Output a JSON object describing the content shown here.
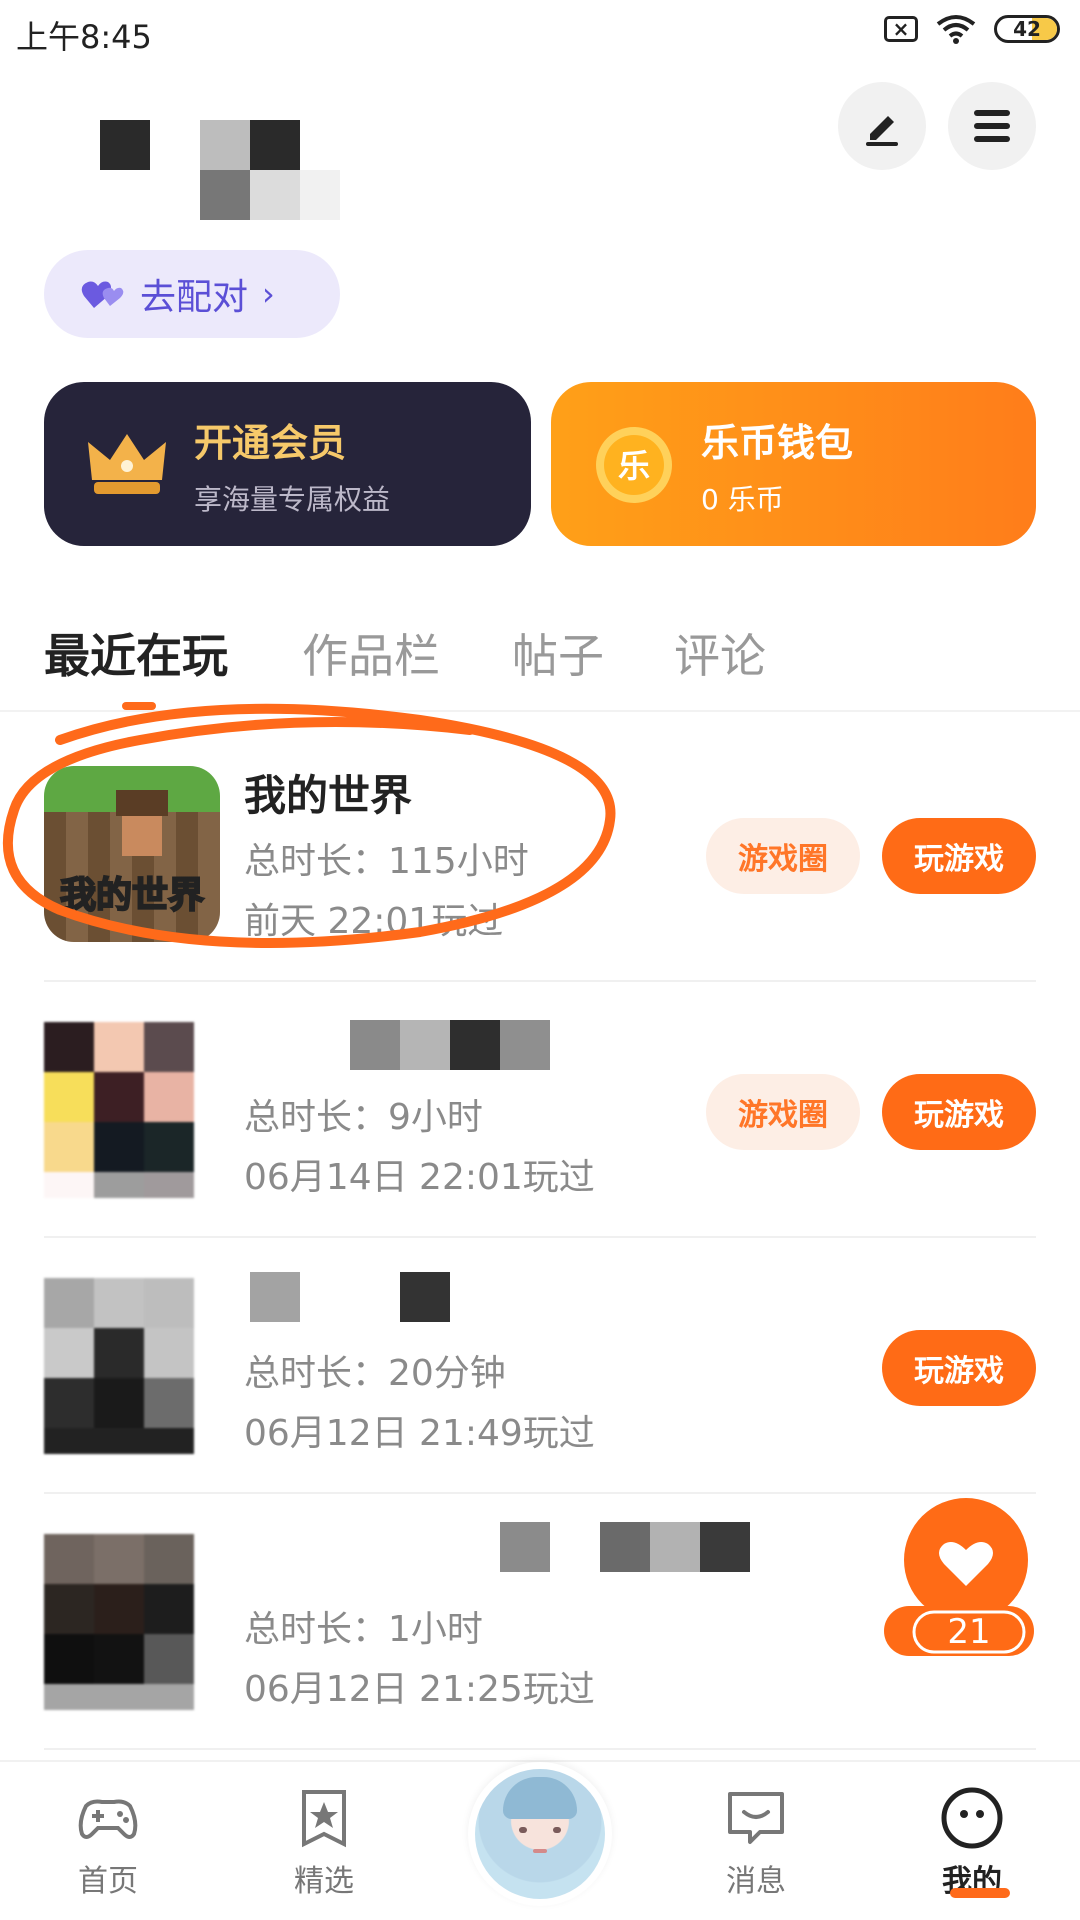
{
  "status_bar": {
    "time": "上午8:45",
    "battery": "42"
  },
  "header": {
    "match_label": "去配对",
    "edit_icon": "edit-icon",
    "menu_icon": "menu-icon"
  },
  "cards": {
    "vip": {
      "title": "开通会员",
      "subtitle": "享海量专属权益"
    },
    "wallet": {
      "title": "乐币钱包",
      "subtitle": "0 乐币",
      "coin_label": "乐"
    }
  },
  "tabs": [
    {
      "label": "最近在玩",
      "active": true
    },
    {
      "label": "作品栏",
      "active": false
    },
    {
      "label": "帖子",
      "active": false
    },
    {
      "label": "评论",
      "active": false
    }
  ],
  "games": [
    {
      "name": "我的世界",
      "duration": "总时长：115小时",
      "last_played": "前天 22:01玩过",
      "icon_text": "我的世界",
      "circle_label": "游戏圈",
      "play_label": "玩游戏"
    },
    {
      "name": "",
      "duration": "总时长：9小时",
      "last_played": "06月14日 22:01玩过",
      "circle_label": "游戏圈",
      "play_label": "玩游戏"
    },
    {
      "name": "",
      "duration": "总时长：20分钟",
      "last_played": "06月12日 21:49玩过",
      "play_label": "玩游戏"
    },
    {
      "name": "",
      "duration": "总时长：1小时",
      "last_played": "06月12日 21:25玩过"
    }
  ],
  "floating_like": {
    "count": "21"
  },
  "bottom_nav": [
    {
      "label": "首页",
      "icon": "gamepad-icon"
    },
    {
      "label": "精选",
      "icon": "star-icon"
    },
    {
      "label": "消息",
      "icon": "message-icon"
    },
    {
      "label": "我的",
      "icon": "profile-face-icon",
      "active": true
    }
  ],
  "colors": {
    "accent": "#ff6b16",
    "match_text": "#5b4fd6",
    "vip_bg": "#26243a",
    "wallet_bg": "#ff8a1a"
  }
}
